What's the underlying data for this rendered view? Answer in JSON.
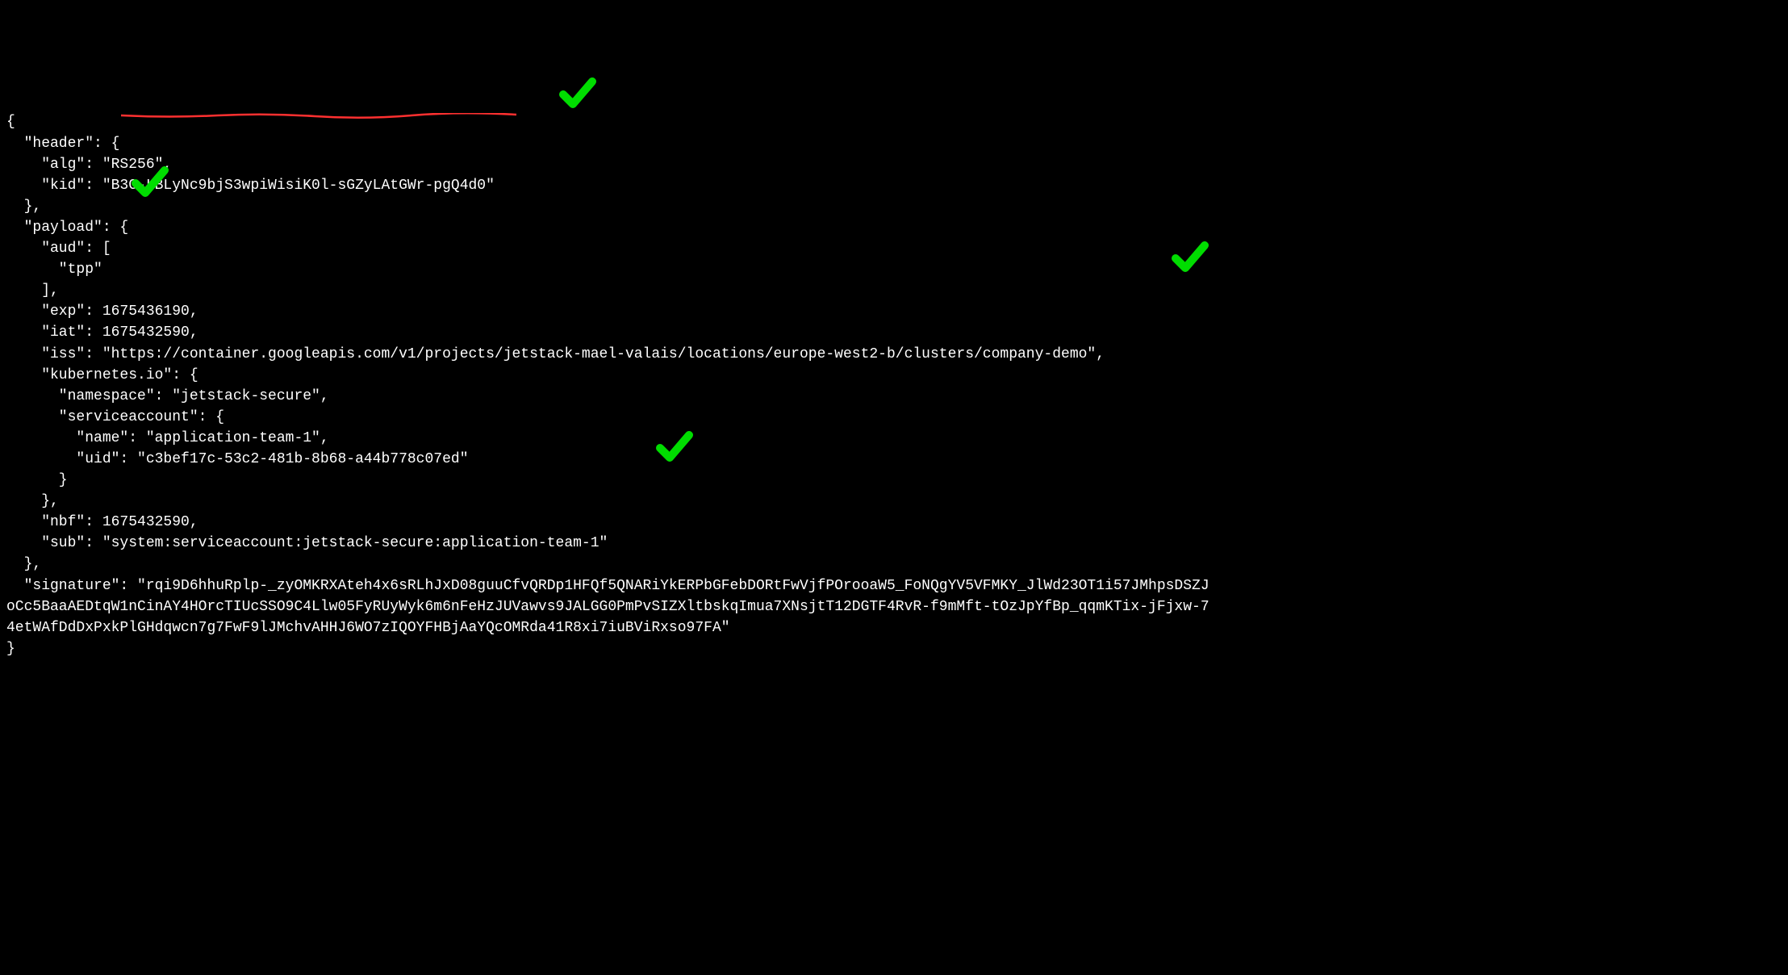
{
  "colors": {
    "background": "#000000",
    "text": "#ffffff",
    "underline": "#ff0000",
    "checkmark": "#00cc00"
  },
  "lines": {
    "l00": "{",
    "l01": "  \"header\": {",
    "l02": "    \"alg\": \"RS256\",",
    "l03": "    \"kid\": \"B3G-LBLyNc9bjS3wpiWisiK0l-sGZyLAtGWr-pgQ4d0\"",
    "l04": "  },",
    "l05": "  \"payload\": {",
    "l06": "    \"aud\": [",
    "l07": "      \"tpp\"",
    "l08": "    ],",
    "l09": "    \"exp\": 1675436190,",
    "l10": "    \"iat\": 1675432590,",
    "l11": "    \"iss\": \"https://container.googleapis.com/v1/projects/jetstack-mael-valais/locations/europe-west2-b/clusters/company-demo\",",
    "l12": "    \"kubernetes.io\": {",
    "l13": "      \"namespace\": \"jetstack-secure\",",
    "l14": "      \"serviceaccount\": {",
    "l15": "        \"name\": \"application-team-1\",",
    "l16": "        \"uid\": \"c3bef17c-53c2-481b-8b68-a44b778c07ed\"",
    "l17": "      }",
    "l18": "    },",
    "l19": "    \"nbf\": 1675432590,",
    "l20": "    \"sub\": \"system:serviceaccount:jetstack-secure:application-team-1\"",
    "l21": "  },",
    "l22_a": "  \"signature\": \"rqi9D6hhuRplp-_zyOMKRXAteh4x6sRLhJxD08guuCfvQRDp1HFQf5QNARiYkERPbGFebDORtFwVjfPOrooaW5_FoNQgYV5VFMKY_JlWd23OT1i57JMhpsDSZJ",
    "l22_b": "oCc5BaaAEDtqW1nCinAY4HOrcTIUcSSO9C4Llw05FyRUyWyk6m6nFeHzJUVawvs9JALGG0PmPvSIZXltbskqImua7XNsjtT12DGTF4RvR-f9mMft-tOzJpYfBp_qqmKTix-jFjxw-7",
    "l22_c": "4etWAfDdDxPxkPlGHdqwcn7g7FwF9lJMchvAHHJ6WO7zIQOYFHBjAaYQcOMRda41R8xi7iuBViRxso97FA\"",
    "l23": "}"
  },
  "annotations": {
    "underlined_field": "kid",
    "checkmarks": [
      "kid",
      "aud_tpp",
      "iss",
      "sub"
    ]
  }
}
